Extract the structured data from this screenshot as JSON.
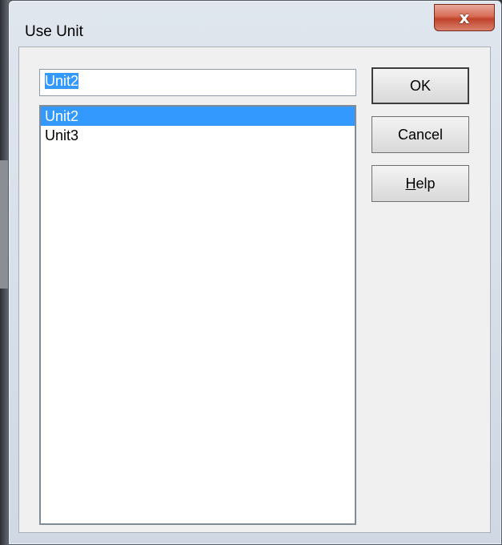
{
  "window": {
    "title": "Use Unit",
    "close_glyph": "x"
  },
  "edit": {
    "value": "Unit2"
  },
  "list": {
    "items": [
      {
        "label": "Unit2",
        "selected": true
      },
      {
        "label": "Unit3",
        "selected": false
      }
    ]
  },
  "buttons": {
    "ok": "OK",
    "cancel": "Cancel",
    "help_mnemonic": "H",
    "help_rest": "elp"
  },
  "colors": {
    "selection": "#3399ff",
    "close_button": "#c0432a"
  }
}
